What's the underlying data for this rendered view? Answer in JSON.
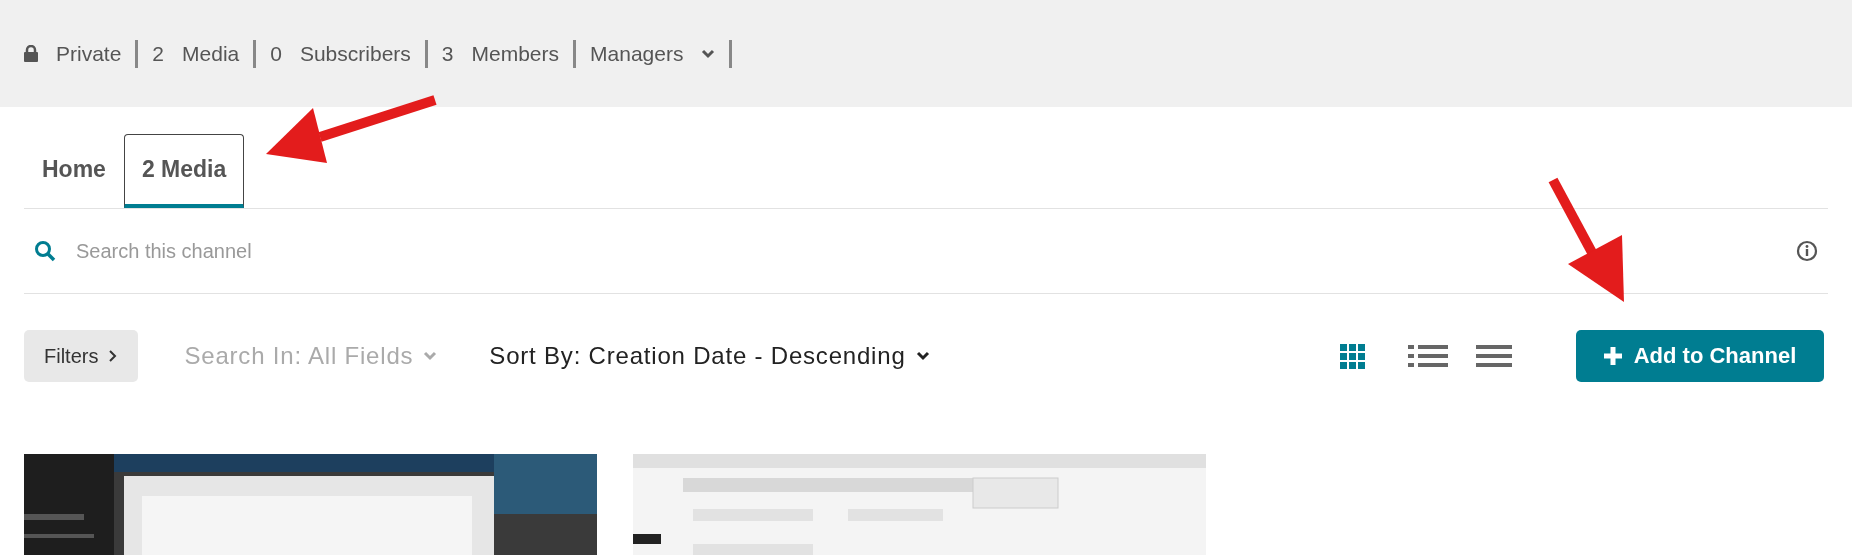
{
  "channel_info": [
    {
      "kind": "lock",
      "label": "Private"
    },
    {
      "kind": "count",
      "count": "2",
      "label": "Media"
    },
    {
      "kind": "count",
      "count": "0",
      "label": "Subscribers"
    },
    {
      "kind": "count",
      "count": "3",
      "label": "Members"
    },
    {
      "kind": "menu",
      "label": "Managers"
    }
  ],
  "tabs": [
    {
      "label": "Home",
      "selected": false
    },
    {
      "label": "2 Media",
      "selected": true
    }
  ],
  "search": {
    "placeholder": "Search this channel"
  },
  "toolbar": {
    "filters": "Filters",
    "search_in": "Search In: All Fields",
    "sort_by": "Sort By: Creation Date - Descending",
    "add_button": "Add to Channel"
  },
  "views": [
    {
      "kind": "grid",
      "selected": true
    },
    {
      "kind": "list",
      "selected": false
    },
    {
      "kind": "lines",
      "selected": false
    }
  ]
}
